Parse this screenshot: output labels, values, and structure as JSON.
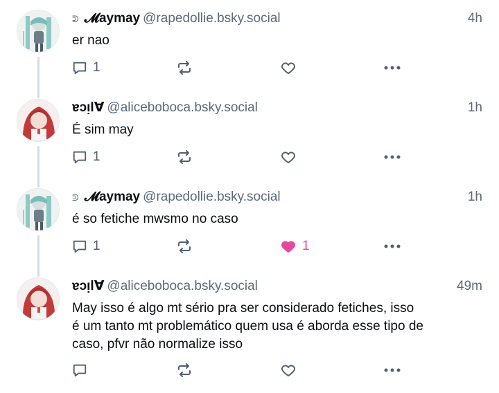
{
  "posts": [
    {
      "display_name": "𝓜aymay",
      "name_prefix": "ᕲ",
      "handle": "@rapedollie.bsky.social",
      "time": "4h",
      "text": [
        "er nao"
      ],
      "reply_count": "1",
      "repost_count": "",
      "like_count": "",
      "liked": false,
      "avatar": "anime-girl-teal-hair"
    },
    {
      "display_name": "ɐɔᴉl∀",
      "name_prefix": "",
      "handle": "@aliceboboca.bsky.social",
      "time": "1h",
      "text": [
        "É sim may"
      ],
      "reply_count": "1",
      "repost_count": "",
      "like_count": "",
      "liked": false,
      "avatar": "anime-girl-red-hair"
    },
    {
      "display_name": "𝓜aymay",
      "name_prefix": "ᕲ",
      "handle": "@rapedollie.bsky.social",
      "time": "1h",
      "text": [
        "é so fetiche mwsmo no caso"
      ],
      "reply_count": "1",
      "repost_count": "",
      "like_count": "1",
      "liked": true,
      "avatar": "anime-girl-teal-hair"
    },
    {
      "display_name": "ɐɔᴉl∀",
      "name_prefix": "",
      "handle": "@aliceboboca.bsky.social",
      "time": "49m",
      "text": [
        "May isso é algo mt sério pra ser considerado fetiches, isso",
        "é um tanto mt problemático quem usa é aborda esse tipo de",
        "caso, pfvr não normalize isso"
      ],
      "reply_count": "",
      "repost_count": "",
      "like_count": "",
      "liked": false,
      "avatar": "anime-girl-red-hair"
    }
  ],
  "colors": {
    "text": "#0b0f14",
    "muted": "#5a6b7c",
    "icon": "#4f6072",
    "like_active": "#e5489f",
    "thread_line": "#d4dde6"
  },
  "icons": {
    "reply": "speech-bubble-icon",
    "repost": "repost-arrows-icon",
    "like": "heart-icon",
    "more": "more-dots-icon"
  }
}
